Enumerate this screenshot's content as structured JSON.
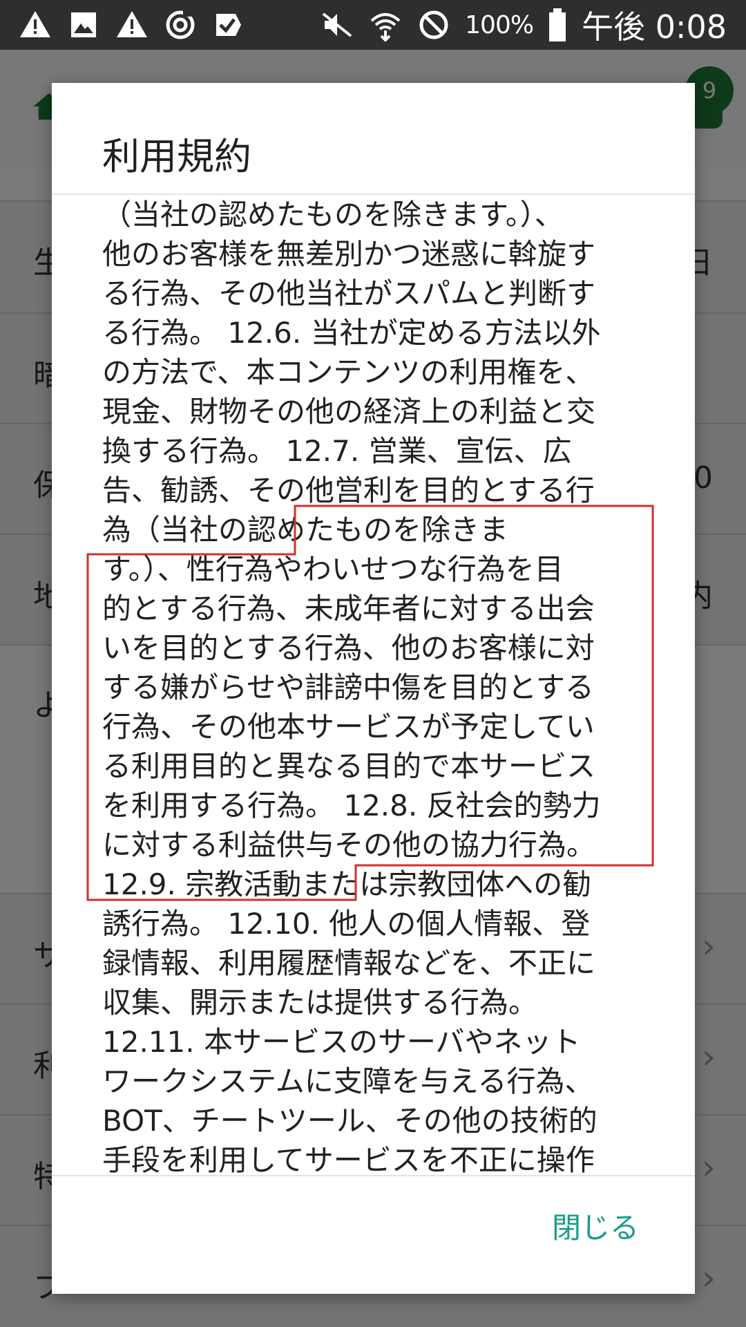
{
  "status_bar": {
    "battery_percent": "100%",
    "time": "午後 0:08",
    "icons": [
      "warning-icon",
      "image-icon",
      "warning-icon",
      "sync-icon",
      "checkbox-icon",
      "mute-icon",
      "wifi-icon",
      "block-icon",
      "battery-icon"
    ]
  },
  "background": {
    "badge_count": "9",
    "rows": [
      {
        "label": "生",
        "value": "日"
      },
      {
        "label": "暗",
        "value": ""
      },
      {
        "label": "保",
        "value": "0"
      },
      {
        "label": "地",
        "value": "内"
      },
      {
        "label": "よ",
        "value": ""
      },
      {
        "label": "サ",
        "value": ""
      },
      {
        "label": "利",
        "value": ""
      },
      {
        "label": "特",
        "value": ""
      },
      {
        "label": "プ",
        "value": ""
      }
    ]
  },
  "dialog": {
    "title": "利用規約",
    "lines": [
      "（当社の認めたものを除きます。）、",
      "他のお客様を無差別かつ迷惑に斡旋す",
      "る行為、その他当社がスパムと判断す",
      "る行為。 12.6. 当社が定める方法以外",
      "の方法で、本コンテンツの利用権を、",
      "現金、財物その他の経済上の利益と交",
      "換する行為。 12.7. 営業、宣伝、広",
      "告、勧誘、その他営利を目的とする行",
      "為（当社の認めたものを除きま",
      "す。）、性行為やわいせつな行為を目",
      "的とする行為、未成年者に対する出会",
      "いを目的とする行為、他のお客様に対",
      "する嫌がらせや誹謗中傷を目的とする",
      "行為、その他本サービスが予定してい",
      "る利用目的と異なる目的で本サービス",
      "を利用する行為。 12.8. 反社会的勢力",
      "に対する利益供与その他の協力行為。",
      "12.9. 宗教活動または宗教団体への勧",
      "誘行為。 12.10. 他人の個人情報、登",
      "録情報、利用履歴情報などを、不正に",
      "収集、開示または提供する行為。",
      "12.11. 本サービスのサーバやネット",
      "ワークシステムに支障を与える行為、",
      "BOT、チートツール、その他の技術的",
      "手段を利用してサービスを不正に操作"
    ],
    "close_label": "閉じる"
  },
  "colors": {
    "accent": "#1a9c8a",
    "highlight": "#d32f2f",
    "brand_green": "#1e7a37"
  }
}
